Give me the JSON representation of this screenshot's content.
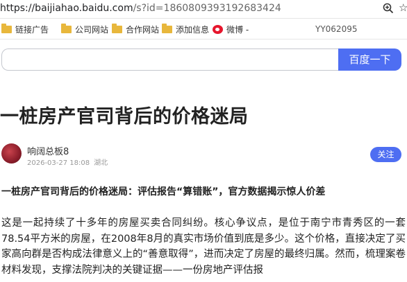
{
  "browser": {
    "url_host": "https://baijiahao.baidu.com",
    "url_rest": "/s?id=1860809393192683424",
    "bookmarks": [
      {
        "label": "链接广告",
        "type": "folder"
      },
      {
        "label": "公司网站",
        "type": "folder"
      },
      {
        "label": "合作网站",
        "type": "folder"
      },
      {
        "label": "添加信息",
        "type": "folder"
      },
      {
        "label": "微博 -",
        "type": "weibo"
      }
    ],
    "bookmark_extra": "YY062095"
  },
  "search": {
    "placeholder": "",
    "button_label": "百度一下"
  },
  "article": {
    "title": "一桩房产官司背后的价格迷局",
    "author": "响阔总板8",
    "datetime": "2026-03-27 18:08",
    "location": "湖北",
    "follow_label": "关注",
    "subtitle": "一桩房产官司背后的价格迷局：评估报告“算错账”，官方数据揭示惊人价差",
    "paragraph": "这是一起持续了十多年的房屋买卖合同纠纷。核心争议点，是位于南宁市青秀区的一套78.54平方米的房屋，在2008年8月的真实市场价值到底是多少。这个价格，直接决定了买家高向群是否构成法律意义上的“善意取得”，进而决定了房屋的最终归属。然而，梳理案卷材料发现，支撑法院判决的关键证据——一份房地产评估报"
  },
  "colors": {
    "accent": "#4e6ef2",
    "folder": "#e8b73c",
    "weibo": "#e6162d"
  }
}
